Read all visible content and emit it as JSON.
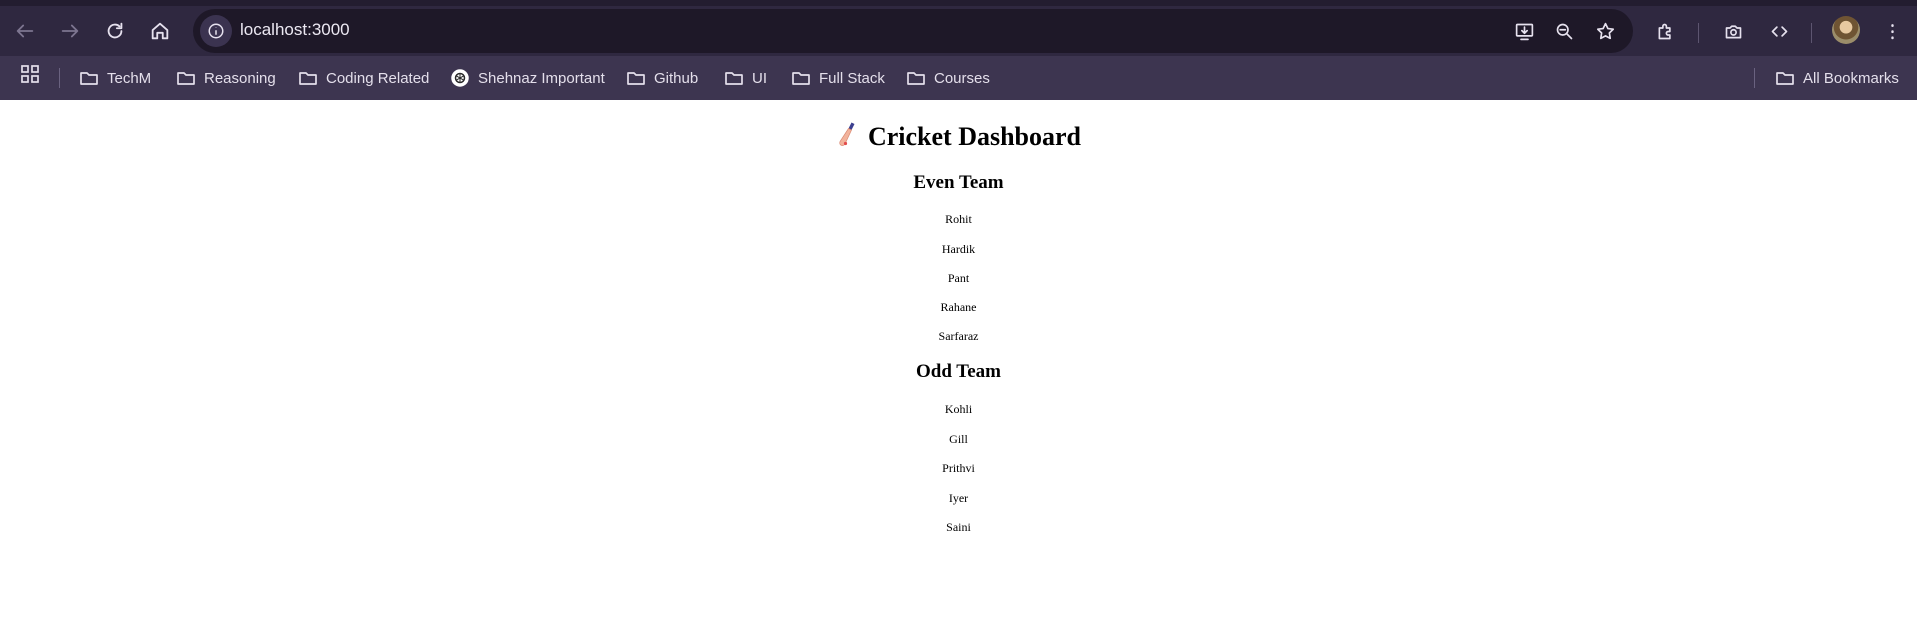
{
  "browser": {
    "url": "localhost:3000",
    "bookmarks": [
      {
        "label": "TechM",
        "icon": "folder-icon"
      },
      {
        "label": "Reasoning",
        "icon": "folder-icon"
      },
      {
        "label": "Coding Related",
        "icon": "folder-icon"
      },
      {
        "label": "Shehnaz Important",
        "icon": "openai-icon"
      },
      {
        "label": "Github",
        "icon": "folder-icon"
      },
      {
        "label": "UI",
        "icon": "folder-icon"
      },
      {
        "label": "Full Stack",
        "icon": "folder-icon"
      },
      {
        "label": "Courses",
        "icon": "folder-icon"
      }
    ],
    "all_bookmarks_label": "All Bookmarks",
    "colors": {
      "toolbar": "#2f2840",
      "bookmark_bar": "#3d3550",
      "omnibox": "#1e1828"
    }
  },
  "page": {
    "title": "Cricket Dashboard",
    "title_icon": "cricket-bat-icon",
    "teams": [
      {
        "heading": "Even Team",
        "players": [
          "Rohit",
          "Hardik",
          "Pant",
          "Rahane",
          "Sarfaraz"
        ]
      },
      {
        "heading": "Odd Team",
        "players": [
          "Kohli",
          "Gill",
          "Prithvi",
          "Iyer",
          "Saini"
        ]
      }
    ]
  }
}
